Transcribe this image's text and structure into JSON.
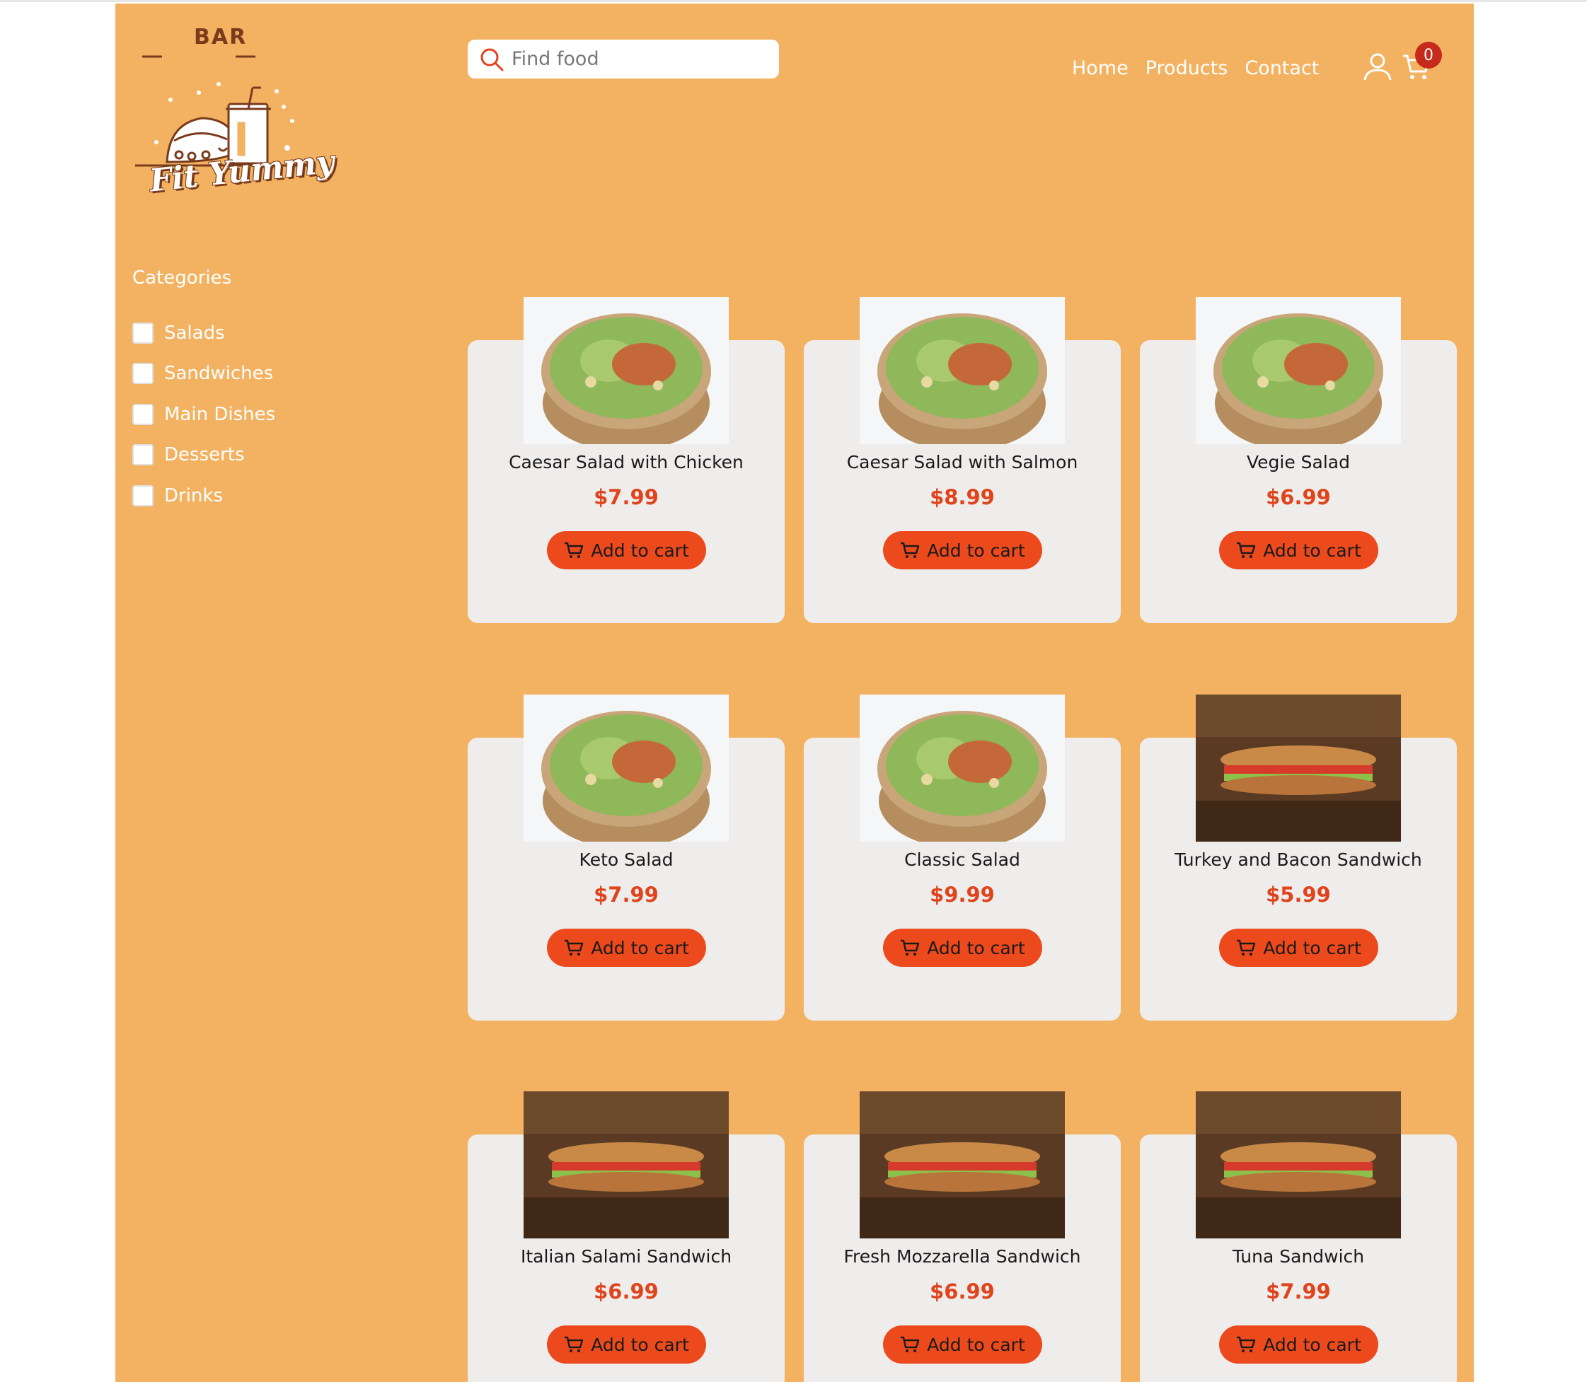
{
  "header": {
    "logo_top_text": "BAR",
    "logo_brand": "Fit Yummy",
    "search_placeholder": "Find food",
    "nav": [
      "Home",
      "Products",
      "Contact"
    ],
    "cart_count": "0"
  },
  "sidebar": {
    "title": "Categories",
    "categories": [
      "Salads",
      "Sandwiches",
      "Main Dishes",
      "Desserts",
      "Drinks"
    ]
  },
  "products": [
    {
      "name": "Caesar Salad with Chicken",
      "price": "$7.99",
      "button": "Add to cart",
      "image": "salad-bowl"
    },
    {
      "name": "Caesar Salad with Salmon",
      "price": "$8.99",
      "button": "Add to cart",
      "image": "salad-bowl"
    },
    {
      "name": "Vegie Salad",
      "price": "$6.99",
      "button": "Add to cart",
      "image": "salad-bowl"
    },
    {
      "name": "Keto Salad",
      "price": "$7.99",
      "button": "Add to cart",
      "image": "salad-bowl"
    },
    {
      "name": "Classic Salad",
      "price": "$9.99",
      "button": "Add to cart",
      "image": "salad-bowl"
    },
    {
      "name": "Turkey and Bacon Sandwich",
      "price": "$5.99",
      "button": "Add to cart",
      "image": "sandwich"
    },
    {
      "name": "Italian Salami Sandwich",
      "price": "$6.99",
      "button": "Add to cart",
      "image": "sandwich"
    },
    {
      "name": "Fresh Mozzarella Sandwich",
      "price": "$6.99",
      "button": "Add to cart",
      "image": "sandwich"
    },
    {
      "name": "Tuna Sandwich",
      "price": "$7.99",
      "button": "Add to cart",
      "image": "sandwich"
    }
  ],
  "colors": {
    "page_bg": "#f2b261",
    "card_bg": "#efedec",
    "accent": "#ec4a1c",
    "price": "#e0441c",
    "badge": "#c62a1a"
  }
}
